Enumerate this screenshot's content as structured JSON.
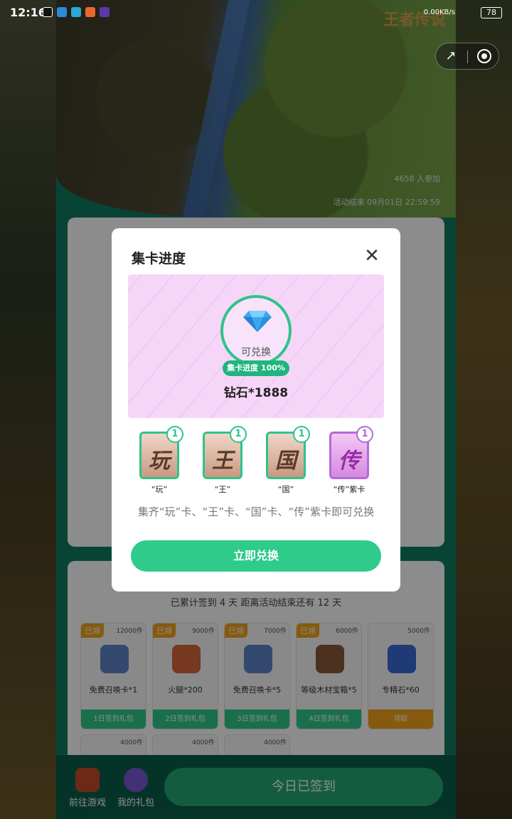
{
  "status_bar": {
    "time": "12:16",
    "network": "0.00KB/s",
    "battery": "78"
  },
  "hero": {
    "logo": "王者传说",
    "participants": "4658 人参加",
    "end_time": "活动结束 09月01日 22:59:59"
  },
  "checkin": {
    "summary": "已累计签到 4 天  距离活动结束还有 12 天",
    "days": [
      {
        "got": "已领",
        "count": "12000件",
        "name": "免费召唤卡*1",
        "foot": "1日签到礼包",
        "color": "#5d86c8"
      },
      {
        "got": "已领",
        "count": "9000件",
        "name": "火腿*200",
        "foot": "2日签到礼包",
        "color": "#d8663a"
      },
      {
        "got": "已领",
        "count": "7000件",
        "name": "免费召唤卡*5",
        "foot": "3日签到礼包",
        "color": "#5d86c8"
      },
      {
        "got": "已领",
        "count": "6000件",
        "name": "等级木材宝箱*5",
        "foot": "4日签到礼包",
        "color": "#8a5a3a"
      },
      {
        "got": "",
        "count": "5000件",
        "name": "专精石*60",
        "foot": "领取",
        "color": "#3a6ad8"
      }
    ],
    "row2_counts": [
      "4000件",
      "4000件",
      "4000件"
    ]
  },
  "bottom_bar": {
    "go_game": "前往游戏",
    "my_gifts": "我的礼包",
    "checkin_button": "今日已签到"
  },
  "modal": {
    "title": "集卡进度",
    "close_icon": "close-icon",
    "redeemable": "可兑换",
    "progress_badge": "集卡进度 100%",
    "reward": "钻石*1888",
    "cards": [
      {
        "glyph": "玩",
        "count": "1",
        "label": "“玩”",
        "purple": false
      },
      {
        "glyph": "王",
        "count": "1",
        "label": "“王”",
        "purple": false
      },
      {
        "glyph": "国",
        "count": "1",
        "label": "“国”",
        "purple": false
      },
      {
        "glyph": "传",
        "count": "1",
        "label": "“传”紫卡",
        "purple": true
      }
    ],
    "instruction": "集齐“玩”卡、“王”卡、“国”卡、“传”紫卡即可兑换",
    "redeem_button": "立即兑换"
  },
  "colors": {
    "accent": "#2ecb8a",
    "purple": "#b36ad8",
    "gold": "#f2a41c"
  }
}
